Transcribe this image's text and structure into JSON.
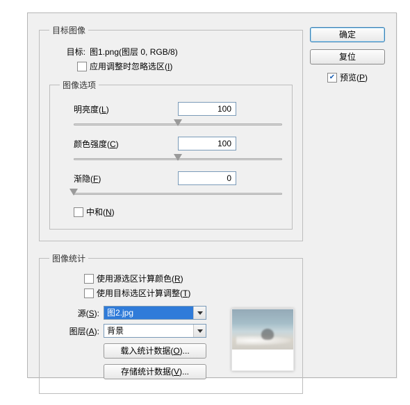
{
  "buttons": {
    "ok": "确定",
    "reset": "复位"
  },
  "preview": {
    "label": "预览(P)",
    "checked": true
  },
  "target_group": {
    "legend": "目标图像",
    "target_label": "目标:",
    "target_value": "图1.png(图层 0, RGB/8)",
    "ignore_selection": {
      "label": "应用调整时忽略选区(I)",
      "checked": false
    }
  },
  "image_options": {
    "legend": "图像选项",
    "luminance": {
      "label": "明亮度(L)",
      "value": "100",
      "pos": 50
    },
    "intensity": {
      "label": "颜色强度(C)",
      "value": "100",
      "pos": 50
    },
    "fade": {
      "label": "渐隐(F)",
      "value": "0",
      "pos": 0
    },
    "neutralize": {
      "label": "中和(N)",
      "checked": false
    }
  },
  "stats_group": {
    "legend": "图像统计",
    "use_source_sel": {
      "label": "使用源选区计算颜色(R)",
      "checked": false
    },
    "use_target_sel": {
      "label": "使用目标选区计算调整(T)",
      "checked": false
    },
    "source_label": "源(S):",
    "source_value": "图2.jpg",
    "layer_label": "图层(A):",
    "layer_value": "背景",
    "load_btn": "载入统计数据(O)...",
    "save_btn": "存储统计数据(V)..."
  }
}
